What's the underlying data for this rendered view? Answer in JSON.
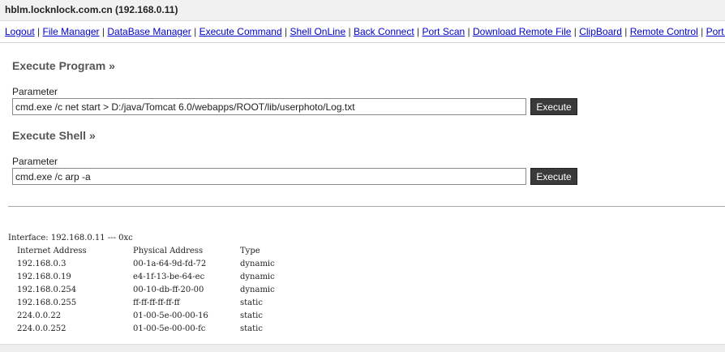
{
  "header": {
    "host": "hblm.locknlock.com.cn",
    "ip": "(192.168.0.11)"
  },
  "nav": {
    "items": [
      "Logout",
      "File Manager",
      "DataBase Manager",
      "Execute Command",
      "Shell OnLine",
      "Back Connect",
      "Port Scan",
      "Download Remote File",
      "ClipBoard",
      "Remote Control",
      "Port Map"
    ],
    "separator": "|"
  },
  "execute_program": {
    "title": "Execute Program",
    "raquo": "»",
    "param_label": "Parameter",
    "value": "cmd.exe /c net start > D:/java/Tomcat 6.0/webapps/ROOT/lib/userphoto/Log.txt",
    "button_label": "Execute"
  },
  "execute_shell": {
    "title": "Execute Shell",
    "raquo": "»",
    "param_label": "Parameter",
    "value": "cmd.exe /c arp -a",
    "button_label": "Execute"
  },
  "output": {
    "interface_line": "Interface: 192.168.0.11 --- 0xc",
    "headers": [
      "Internet Address",
      "Physical Address",
      "Type"
    ],
    "rows": [
      [
        "192.168.0.3",
        "00-1a-64-9d-fd-72",
        "dynamic"
      ],
      [
        "192.168.0.19",
        "e4-1f-13-be-64-ec",
        "dynamic"
      ],
      [
        "192.168.0.254",
        "00-10-db-ff-20-00",
        "dynamic"
      ],
      [
        "192.168.0.255",
        "ff-ff-ff-ff-ff-ff",
        "static"
      ],
      [
        "224.0.0.22",
        "01-00-5e-00-00-16",
        "static"
      ],
      [
        "224.0.0.252",
        "01-00-5e-00-00-fc",
        "static"
      ]
    ]
  },
  "colors": {
    "link": "#0000cc",
    "button_bg": "#3a3a3a",
    "button_text": "#ffffff",
    "section_title": "#555555",
    "header_bg": "#f1f1f1"
  }
}
